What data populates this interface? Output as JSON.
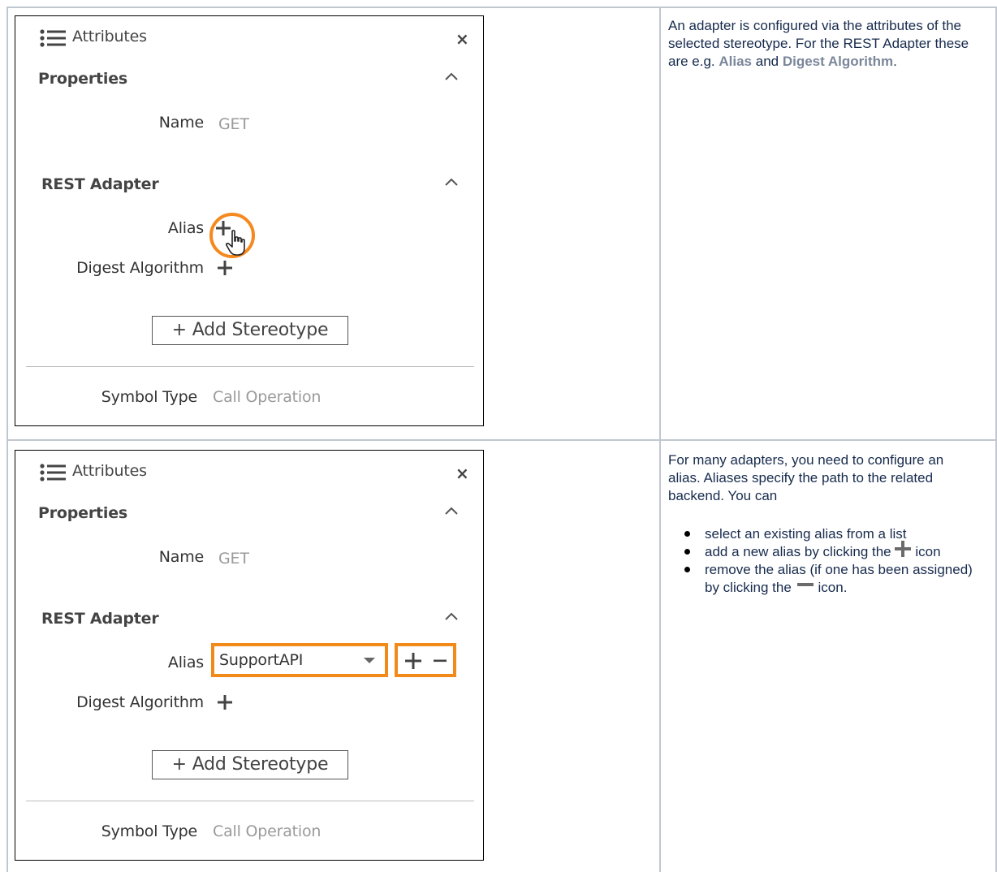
{
  "panel1": {
    "header_title": "Attributes",
    "close_symbol": "×",
    "section_properties": "Properties",
    "name_label": "Name",
    "name_value": "GET",
    "section_adapter": "REST Adapter",
    "alias_label": "Alias",
    "digest_label": "Digest Algorithm",
    "add_stereotype": "+ Add Stereotype",
    "symbol_type_label": "Symbol Type",
    "symbol_type_value": "Call Operation"
  },
  "panel2": {
    "header_title": "Attributes",
    "close_symbol": "×",
    "section_properties": "Properties",
    "name_label": "Name",
    "name_value": "GET",
    "section_adapter": "REST Adapter",
    "alias_label": "Alias",
    "alias_value": "SupportAPI",
    "digest_label": "Digest Algorithm",
    "add_stereotype": "+ Add Stereotype",
    "symbol_type_label": "Symbol Type",
    "symbol_type_value": "Call Operation"
  },
  "desc1": {
    "part1": "An adapter is configured via the attributes of the selected stereotype. For the REST Adapter these are e.g. ",
    "alias": "Alias",
    "and": " and ",
    "digest": "Digest Algorithm",
    "end": "."
  },
  "desc2": {
    "intro": "For many adapters, you need to configure an alias. Aliases specify the path to the related backend. You can",
    "bullet1": "select an existing alias from a list",
    "bullet2_a": "add a new alias by clicking the",
    "bullet2_b": " icon",
    "bullet3_a": "remove the alias (if one has been assigned) by clicking the",
    "bullet3_b": " icon."
  },
  "colors": {
    "highlight": "#f28a1a",
    "table_border": "#c1c7d0",
    "strong_text": "#7a869a"
  },
  "icons": [
    "list-icon",
    "close-icon",
    "caret-up-icon",
    "plus-icon",
    "hand-cursor-icon",
    "minus-icon",
    "dropdown-caret-icon"
  ]
}
